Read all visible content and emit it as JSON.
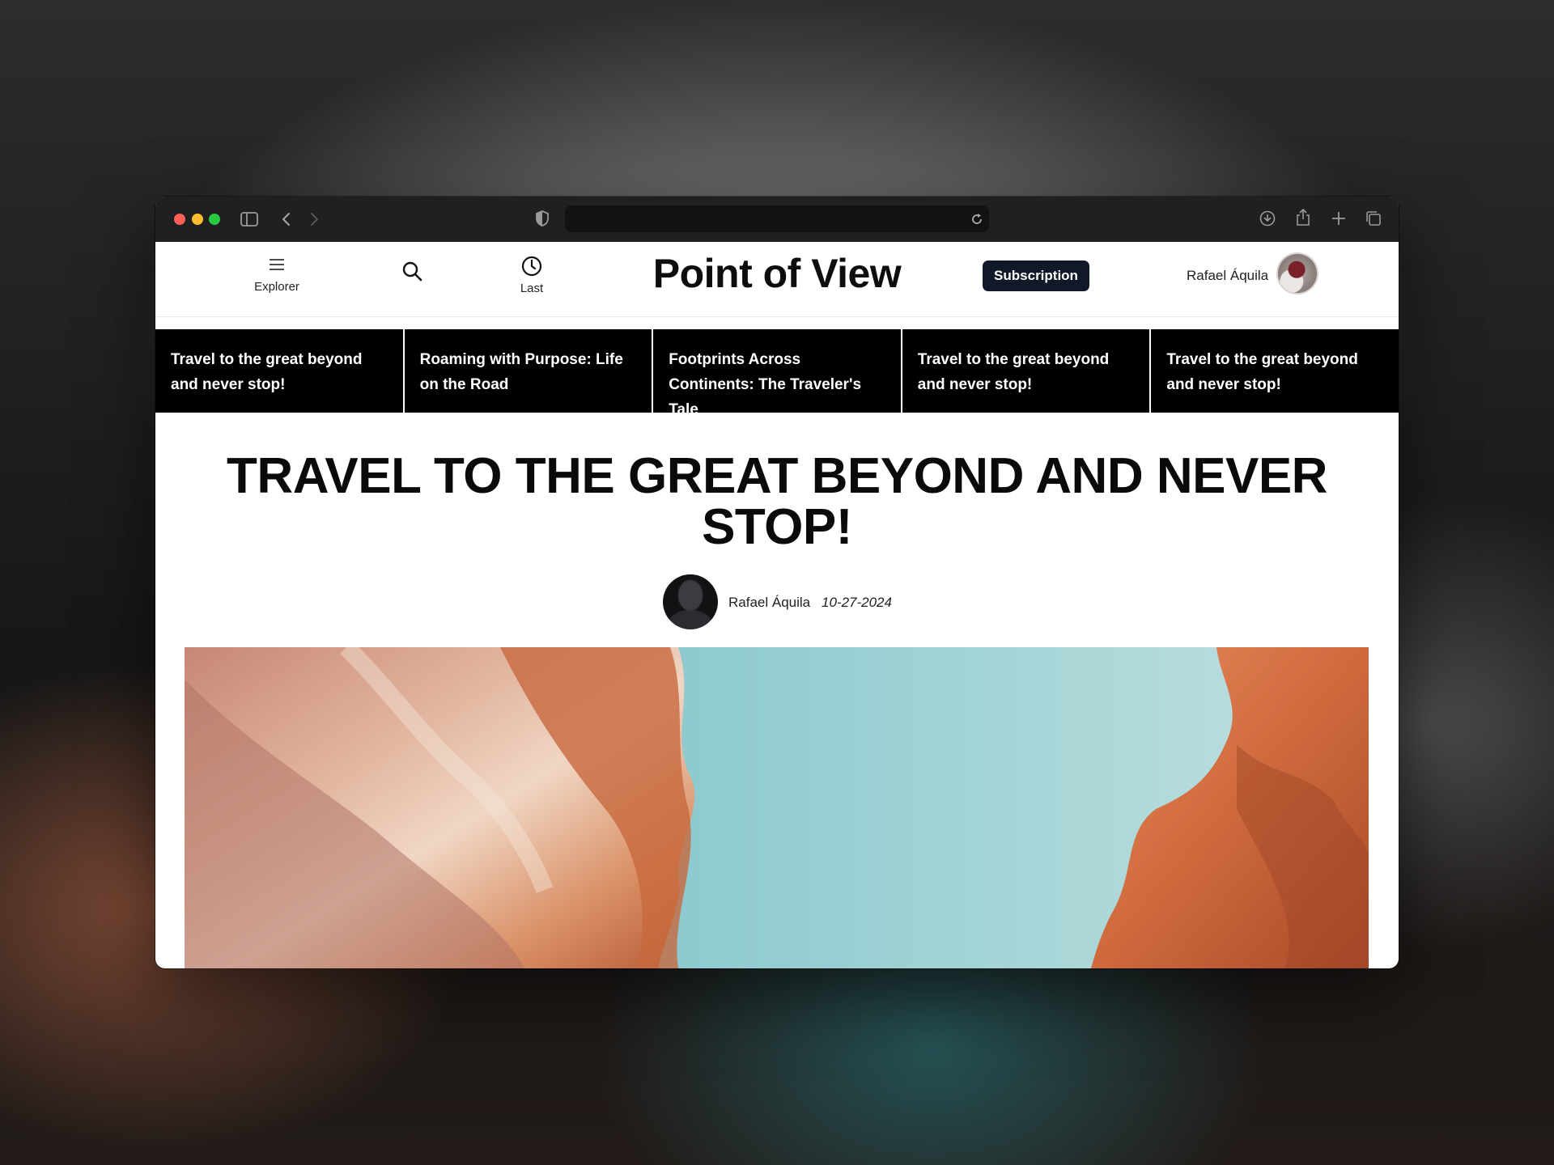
{
  "browser": {
    "url": "",
    "traffic_colors": {
      "close": "#ff5f57",
      "minimize": "#febc2e",
      "maximize": "#28c840"
    }
  },
  "site": {
    "explorer_label": "Explorer",
    "last_label": "Last",
    "logo": "Point of View",
    "subscription_label": "Subscription",
    "user_name": "Rafael Áquila"
  },
  "strip": [
    {
      "title": "Travel to the great beyond and never stop!"
    },
    {
      "title": "Roaming with Purpose: Life on the Road"
    },
    {
      "title": "Footprints Across Continents: The Traveler's Tale"
    },
    {
      "title": "Travel to the great beyond and never stop!"
    },
    {
      "title": "Travel to the great beyond and never stop!"
    }
  ],
  "article": {
    "title": "TRAVEL TO THE GREAT BEYOND AND NEVER STOP!",
    "author": "Rafael Áquila",
    "date": "10-27-2024",
    "hero_description_icon": "canyon-photo"
  }
}
